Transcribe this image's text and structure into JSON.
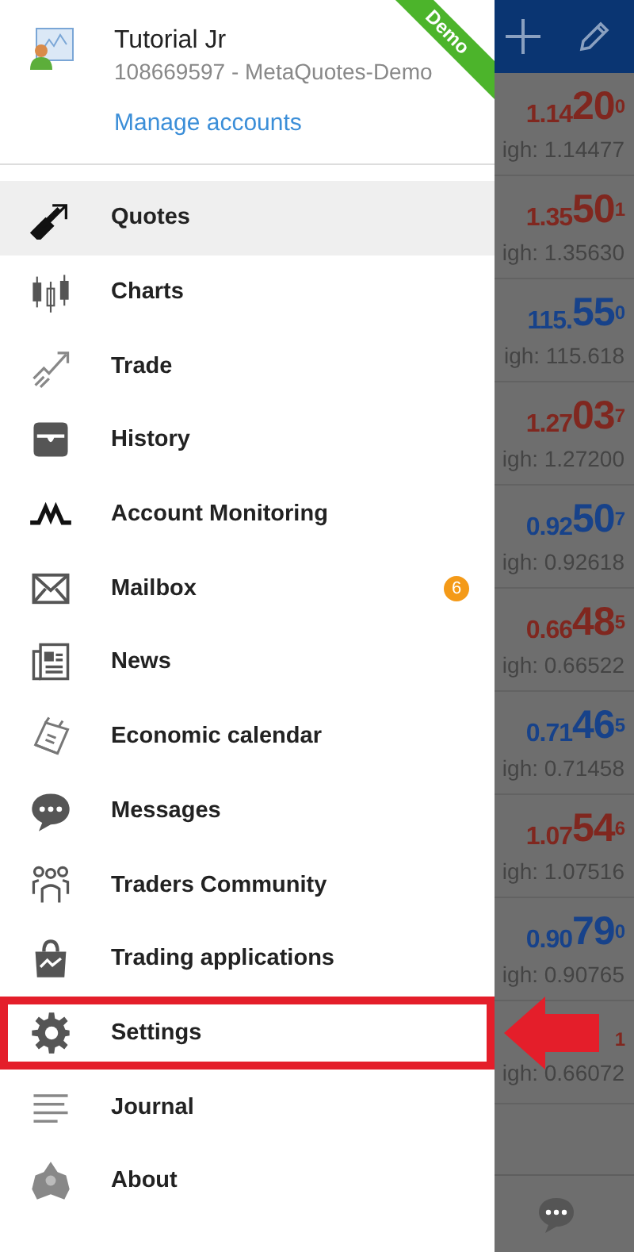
{
  "drawer": {
    "ribbon": "Demo",
    "account": {
      "name": "Tutorial Jr",
      "number": "108669597 - MetaQuotes-Demo",
      "link": "Manage accounts"
    },
    "items": [
      {
        "label": "Quotes",
        "selected": true,
        "highlighted": false
      },
      {
        "label": "Charts",
        "selected": false,
        "highlighted": false
      },
      {
        "label": "Trade",
        "selected": false,
        "highlighted": false
      },
      {
        "label": "History",
        "selected": false,
        "highlighted": false
      },
      {
        "label": "Account Monitoring",
        "selected": false,
        "highlighted": false
      },
      {
        "label": "Mailbox",
        "badge": "6",
        "selected": false,
        "highlighted": false
      },
      {
        "label": "News",
        "selected": false,
        "highlighted": false
      },
      {
        "label": "Economic calendar",
        "selected": false,
        "highlighted": false
      },
      {
        "label": "Messages",
        "selected": false,
        "highlighted": false
      },
      {
        "label": "Traders Community",
        "selected": false,
        "highlighted": false
      },
      {
        "label": "Trading applications",
        "selected": false,
        "highlighted": false
      },
      {
        "label": "Settings",
        "selected": false,
        "highlighted": true
      },
      {
        "label": "Journal",
        "selected": false,
        "highlighted": false
      },
      {
        "label": "About",
        "selected": false,
        "highlighted": false
      }
    ]
  },
  "quotes": [
    {
      "color": "#80271f",
      "price_head": "1.14",
      "price_big": "20",
      "price_sup": "0",
      "high": "igh: 1.14477"
    },
    {
      "color": "#80271f",
      "price_head": "1.35",
      "price_big": "50",
      "price_sup": "1",
      "high": "igh: 1.35630"
    },
    {
      "color": "#17428a",
      "price_head": "115.",
      "price_big": "55",
      "price_sup": "0",
      "high": "igh: 115.618"
    },
    {
      "color": "#80271f",
      "price_head": "1.27",
      "price_big": "03",
      "price_sup": "7",
      "high": "igh: 1.27200"
    },
    {
      "color": "#17428a",
      "price_head": "0.92",
      "price_big": "50",
      "price_sup": "7",
      "high": "igh: 0.92618"
    },
    {
      "color": "#80271f",
      "price_head": "0.66",
      "price_big": "48",
      "price_sup": "5",
      "high": "igh: 0.66522"
    },
    {
      "color": "#17428a",
      "price_head": "0.71",
      "price_big": "46",
      "price_sup": "5",
      "high": "igh: 0.71458"
    },
    {
      "color": "#80271f",
      "price_head": "1.07",
      "price_big": "54",
      "price_sup": "6",
      "high": "igh: 1.07516"
    },
    {
      "color": "#17428a",
      "price_head": "0.90",
      "price_big": "79",
      "price_sup": "0",
      "high": "igh: 0.90765"
    },
    {
      "color": "#80271f",
      "price_sup": "1",
      "high": "igh: 0.66072"
    }
  ]
}
